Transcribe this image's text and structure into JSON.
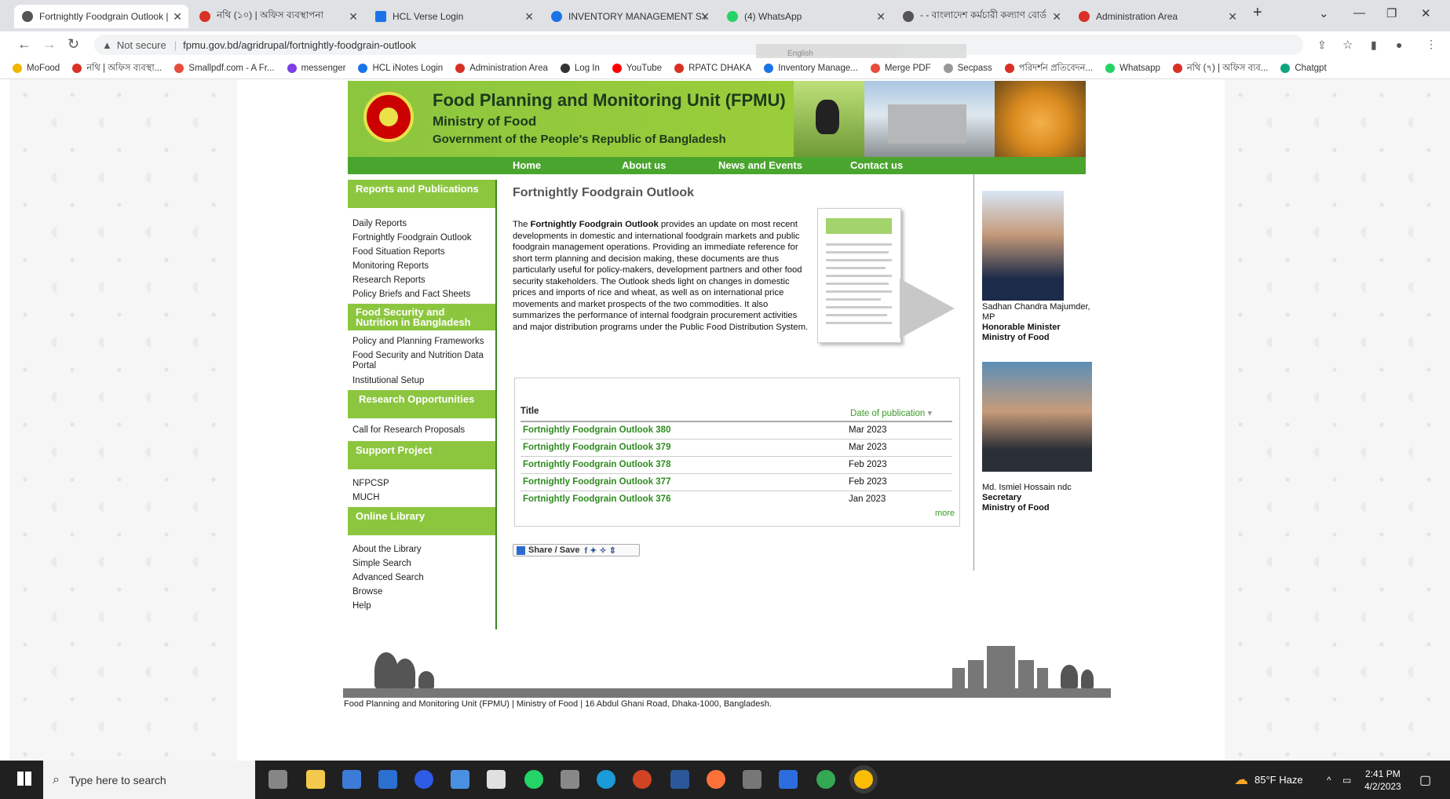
{
  "browser": {
    "tabs": [
      {
        "label": "Fortnightly Foodgrain Outlook |",
        "active": true,
        "color": "#4a4a4a"
      },
      {
        "label": "নথি (১০) | অফিস ব্যবস্থাপনা",
        "color": "#d93025"
      },
      {
        "label": "HCL Verse Login",
        "color": "#1a73e8"
      },
      {
        "label": "INVENTORY MANAGEMENT SYS",
        "color": "#1a73e8"
      },
      {
        "label": "(4) WhatsApp",
        "color": "#25d366"
      },
      {
        "label": "- - বাংলাদেশ কর্মচারী কল্যাণ বোর্ড",
        "color": "#4a4a4a"
      },
      {
        "label": "Administration Area",
        "color": "#d93025"
      }
    ],
    "new_tab": "+",
    "not_secure": "Not secure",
    "url": "fpmu.gov.bd/agridrupal/fortnightly-foodgrain-outlook",
    "translate_text": "English",
    "bookmarks": [
      {
        "label": "MoFood",
        "color": "#f2b600"
      },
      {
        "label": "নথি | অফিস ব্যবস্থা...",
        "color": "#d93025"
      },
      {
        "label": "Smallpdf.com - A Fr...",
        "color": "#e74c3c"
      },
      {
        "label": "messenger",
        "color": "#7b3fe4"
      },
      {
        "label": "HCL iNotes Login",
        "color": "#1a73e8"
      },
      {
        "label": "Administration Area",
        "color": "#d93025"
      },
      {
        "label": "Log In",
        "color": "#333333"
      },
      {
        "label": "YouTube",
        "color": "#ff0000"
      },
      {
        "label": "RPATC DHAKA",
        "color": "#d93025"
      },
      {
        "label": "Inventory Manage...",
        "color": "#1a73e8"
      },
      {
        "label": "Merge PDF",
        "color": "#e74c3c"
      },
      {
        "label": "Secpass",
        "color": "#999999"
      },
      {
        "label": "পরিদর্শন প্রতিবেদন...",
        "color": "#d93025"
      },
      {
        "label": "Whatsapp",
        "color": "#25d366"
      },
      {
        "label": "নথি (৭) | অফিস ব্যব...",
        "color": "#d93025"
      },
      {
        "label": "Chatgpt",
        "color": "#10a37f"
      }
    ]
  },
  "site": {
    "org_title": "Food Planning and Monitoring Unit (FPMU)",
    "ministry": "Ministry of Food",
    "government": "Government of the People's Republic of Bangladesh",
    "nav": [
      "Home",
      "About us",
      "News and Events",
      "Contact us"
    ],
    "sidebar": {
      "sections": [
        {
          "title": "Reports and Publications",
          "items": [
            "Daily Reports",
            "Fortnightly Foodgrain Outlook",
            "Food Situation Reports",
            "Monitoring Reports",
            "Research Reports",
            "Policy Briefs and Fact Sheets"
          ]
        },
        {
          "title": "Food Security and Nutrition in Bangladesh",
          "items": [
            "Policy and Planning Frameworks",
            "Food Security and Nutrition Data Portal",
            "Institutional Setup"
          ]
        },
        {
          "title": "Research Opportunities",
          "items": [
            "Call for Research Proposals"
          ]
        },
        {
          "title": "Support Project",
          "items": [
            "NFPCSP",
            "MUCH"
          ]
        },
        {
          "title": "Online Library",
          "items": [
            "About the Library",
            "Simple Search",
            "Advanced Search",
            "Browse",
            "Help"
          ]
        }
      ]
    },
    "main": {
      "title": "Fortnightly Foodgrain Outlook",
      "desc_prefix": "The ",
      "desc_bold": "Fortnightly Foodgrain Outlook",
      "desc_rest": " provides an update on most recent developments in domestic and international foodgrain markets and public foodgrain management operations. Providing an immediate reference for short term planning and decision making, these documents are thus particularly useful for policy-makers, development partners and other food security stakeholders. The Outlook sheds light on changes in domestic prices and imports of rice and wheat, as well as on international price movements and market prospects of the two commodities. It also summarizes the performance of internal foodgrain procurement activities and major distribution programs under the Public Food Distribution System.",
      "table": {
        "col_title": "Title",
        "col_date": "Date of publication",
        "rows": [
          {
            "title": "Fortnightly Foodgrain Outlook 380",
            "date": "Mar 2023"
          },
          {
            "title": "Fortnightly Foodgrain Outlook 379",
            "date": "Mar 2023"
          },
          {
            "title": "Fortnightly Foodgrain Outlook 378",
            "date": "Feb 2023"
          },
          {
            "title": "Fortnightly Foodgrain Outlook 377",
            "date": "Feb 2023"
          },
          {
            "title": "Fortnightly Foodgrain Outlook 376",
            "date": "Jan 2023"
          }
        ],
        "more": "more"
      },
      "share": "Share / Save"
    },
    "officials": [
      {
        "name": "Sadhan Chandra Majumder, MP",
        "role": "Honorable Minister",
        "org": "Ministry of Food"
      },
      {
        "name": "Md. Ismiel Hossain ndc",
        "role": "Secretary",
        "org": "Ministry of Food"
      }
    ],
    "footer": "Food Planning and Monitoring Unit (FPMU) | Ministry of Food | 16 Abdul Ghani Road, Dhaka-1000, Bangladesh."
  },
  "taskbar": {
    "search_placeholder": "Type here to search",
    "weather": "85°F  Haze",
    "time": "2:41 PM",
    "date": "4/2/2023"
  },
  "colors": {
    "brand_green": "#8cc63f",
    "nav_green": "#4aa52e",
    "link_green": "#2e8b1f"
  }
}
